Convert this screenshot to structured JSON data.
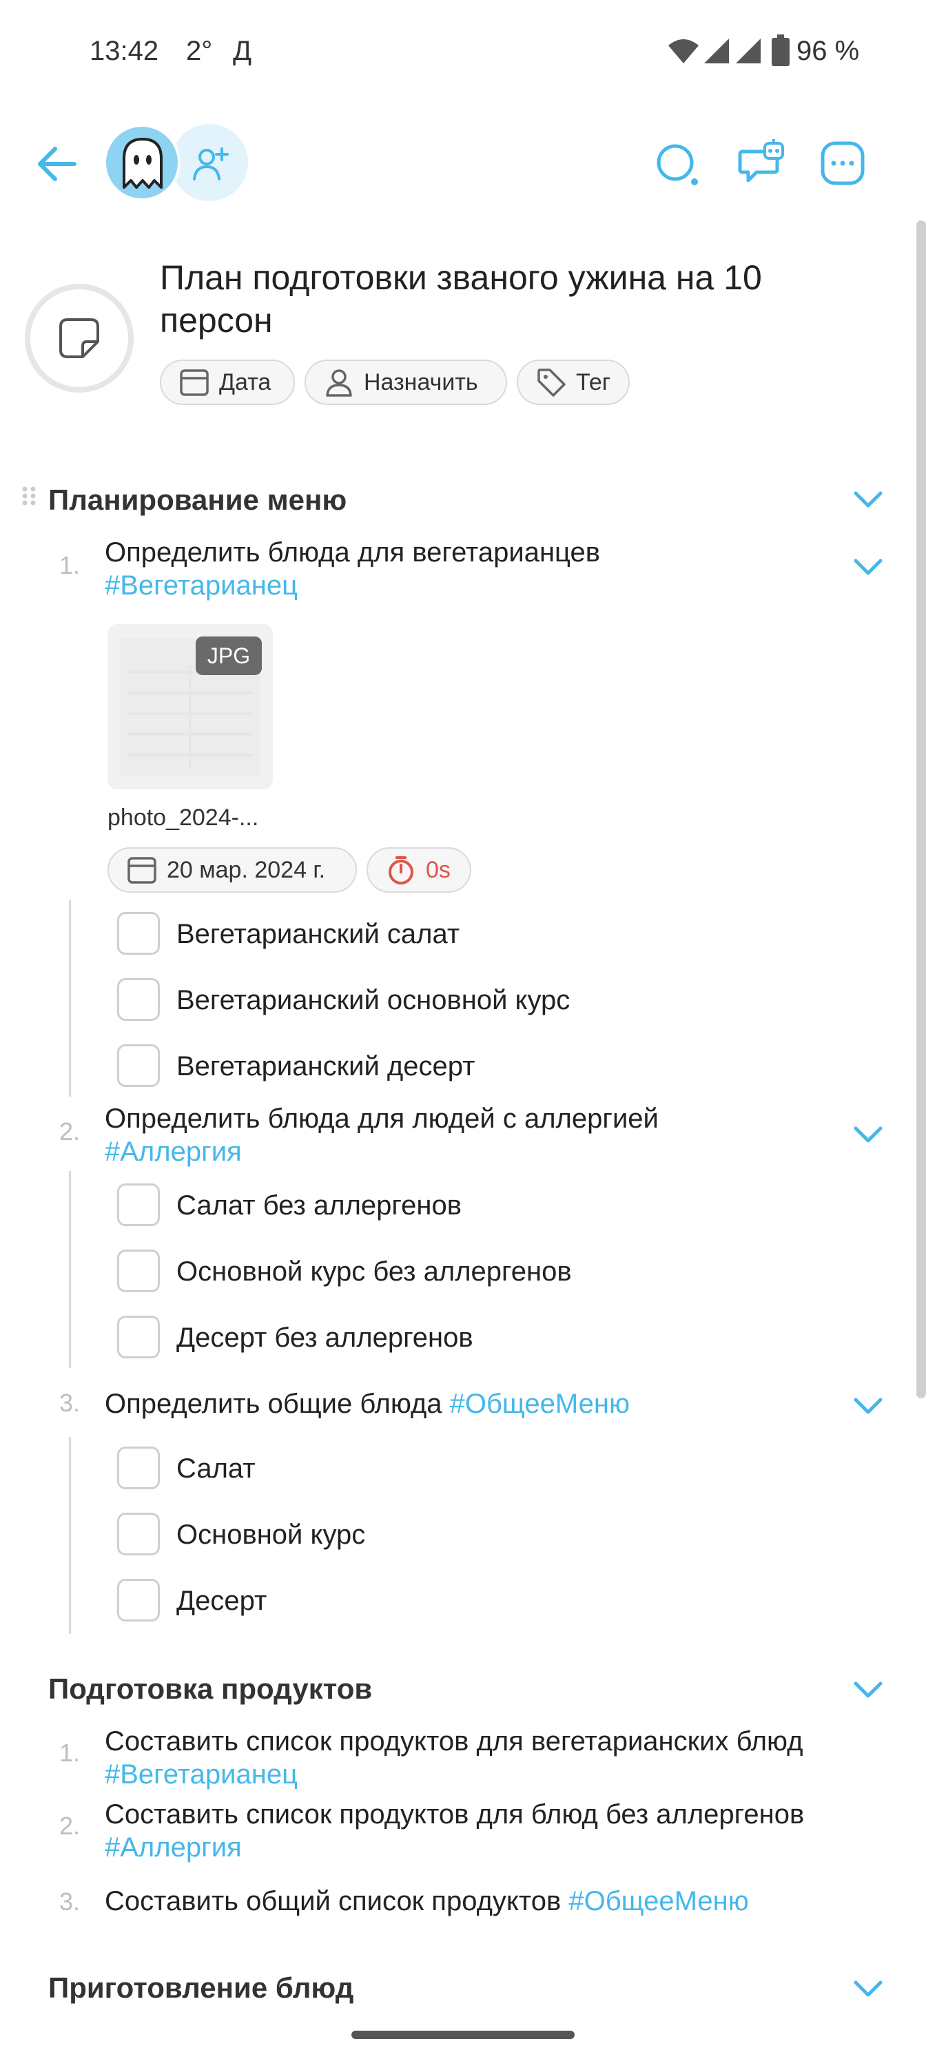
{
  "status_bar": {
    "time": "13:42",
    "temp": "2°",
    "carrier_letter": "Д",
    "battery": "96 %"
  },
  "doc": {
    "title": "План подготовки званого ужина на 10 персон",
    "chips": {
      "date": "Дата",
      "assign": "Назначить",
      "tag": "Тег"
    }
  },
  "sections": [
    {
      "title": "Планирование меню",
      "items": [
        {
          "num": "1.",
          "text": "Определить блюда для вегетарианцев",
          "tag": "#Вегетарианец",
          "attachment": {
            "badge": "JPG",
            "name": "photo_2024-..."
          },
          "date_chip": "20 мар. 2024 г.",
          "timer_chip": "0s",
          "subtasks": [
            "Вегетарианский салат",
            "Вегетарианский основной курс",
            "Вегетарианский десерт"
          ]
        },
        {
          "num": "2.",
          "text": "Определить блюда для людей с аллергией",
          "tag": "#Аллергия",
          "subtasks": [
            "Салат без аллергенов",
            "Основной курс без аллергенов",
            "Десерт без аллергенов"
          ]
        },
        {
          "num": "3.",
          "text": "Определить общие блюда",
          "tag": "#ОбщееМеню",
          "subtasks": [
            "Салат",
            "Основной курс",
            "Десерт"
          ]
        }
      ]
    },
    {
      "title": "Подготовка продуктов",
      "items": [
        {
          "num": "1.",
          "text": "Составить список продуктов для вегетарианских блюд",
          "tag": "#Вегетарианец"
        },
        {
          "num": "2.",
          "text": "Составить список продуктов для блюд без аллергенов",
          "tag": "#Аллергия"
        },
        {
          "num": "3.",
          "text": "Составить общий список продуктов",
          "tag": "#ОбщееМеню"
        }
      ]
    },
    {
      "title": "Приготовление блюд"
    }
  ],
  "icons": {
    "back": "arrow-left-icon",
    "avatar": "ghost-icon",
    "add_user": "add-person-icon",
    "search": "search-icon",
    "ai_chat": "robot-chat-icon",
    "more": "more-dots-icon",
    "doc": "note-page-icon"
  },
  "colors": {
    "accent": "#45b7ea",
    "timer_red": "#e0544a"
  }
}
